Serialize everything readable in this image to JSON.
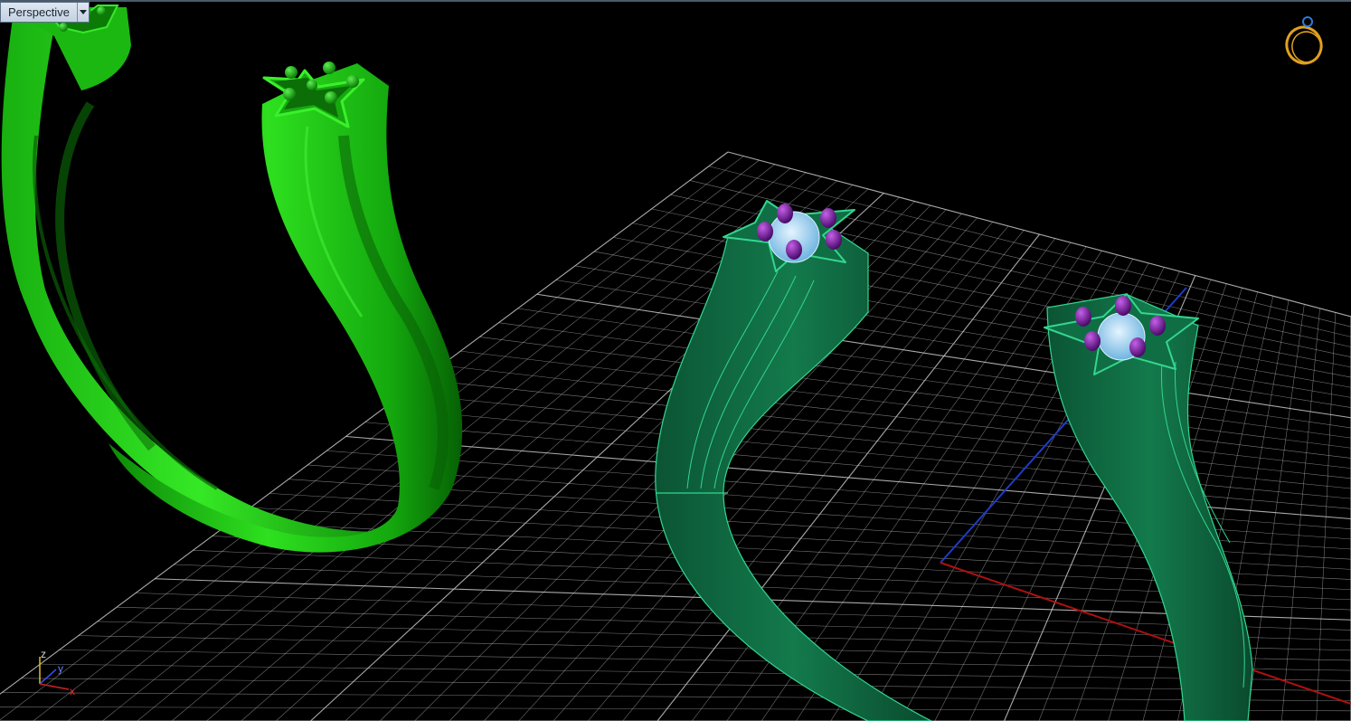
{
  "viewport": {
    "label": "Perspective",
    "menu_icon": "chevron-down-icon",
    "background": "#000000"
  },
  "gizmo": {
    "icon": "ring-rotate-icon",
    "x_label": "x",
    "y_label": "y",
    "z_label": "z"
  },
  "colors": {
    "grid": "#c8c8c8",
    "x_axis": "#b01010",
    "y_axis": "#1e3cc8",
    "selected_ring": "#22c21a",
    "shaded_ring": "#0f6e44",
    "ring_edges": "#33d690",
    "prongs": "#7a1ca0",
    "gem": "#a6d4f2",
    "gizmo_ring": "#e0a020"
  }
}
